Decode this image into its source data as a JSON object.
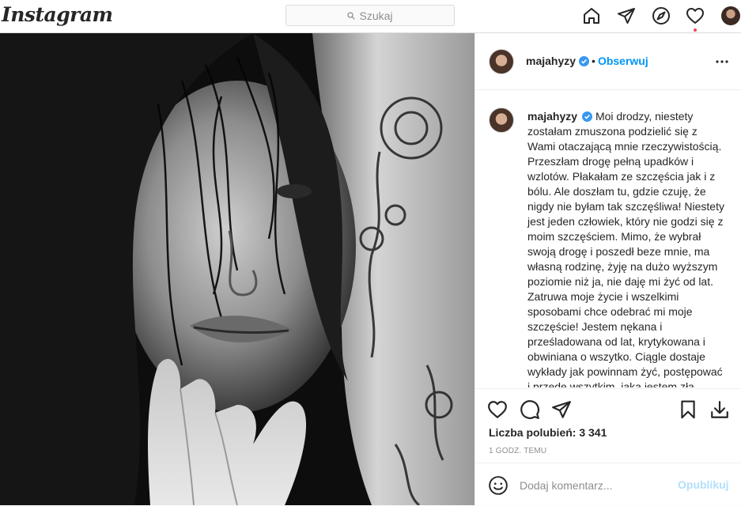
{
  "nav": {
    "logo": "Instagram",
    "search_placeholder": "Szukaj"
  },
  "post": {
    "username": "majahyzy",
    "follow_label": "Obserwuj",
    "caption": "Moi drodzy, niestety zostałam zmuszona podzielić się z Wami otaczającą mnie rzeczywistością. Przeszłam drogę pełną upadków i wzlotów. Płakałam ze szczęścia jak i z bólu. Ale doszłam tu, gdzie czuję, że nigdy nie byłam tak szczęśliwa! Niestety jest jeden człowiek, który nie godzi się z moim szczęściem. Mimo, że wybrał swoją drogę i poszedł beze mnie, ma własną rodzinę, żyję na dużo wyższym poziomie niż ja, nie daję mi żyć od lat. Zatruwa moje życie i wszelkimi sposobami chce odebrać mi moje szczęście! Jestem nękana i prześladowana od lat, krytykowana i obwiniana o wszytko. Ciągle dostaje wykłady jak powinnam żyć, postępować i przede wszytkim, jaką jestem złą matką! Dziś poszedł dzień",
    "likes_text": "Liczba polubień: 3 341",
    "time_text": "1 godz. temu",
    "comment_placeholder": "Dodaj komentarz...",
    "publish_label": "Opublikuj"
  },
  "colors": {
    "accent": "#0095f6",
    "publish_disabled": "#b2dffc",
    "notification": "#ed4956",
    "verified": "#3897f0"
  },
  "icons": {
    "nav": [
      "home-icon",
      "direct-icon",
      "explore-icon",
      "activity-heart-icon",
      "profile-avatar"
    ],
    "actions": [
      "like-heart-icon",
      "comment-icon",
      "share-icon",
      "save-bookmark-icon",
      "download-icon"
    ]
  }
}
